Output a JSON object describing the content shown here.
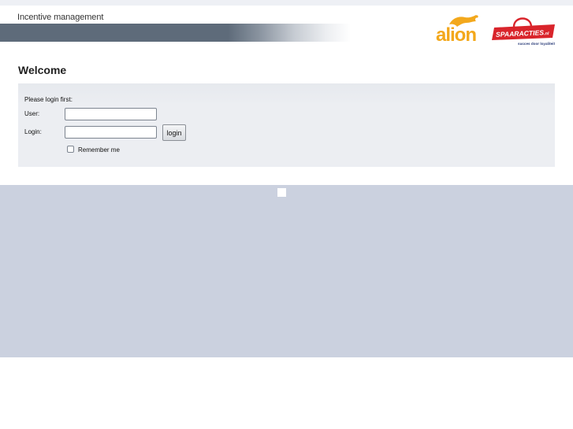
{
  "header": {
    "tagline": "Incentive management",
    "logos": {
      "alion": {
        "text": "alion",
        "color": "#f3a81c"
      },
      "spaaracties": {
        "text": "SPAARACTIES",
        "suffix": ".nl",
        "slogan": "succes door loyaliteit",
        "color": "#d9242b"
      }
    }
  },
  "main": {
    "title": "Welcome",
    "form": {
      "prompt": "Please login first:",
      "user_label": "User:",
      "user_value": "",
      "login_label": "Login:",
      "login_value": "",
      "submit_label": "login",
      "remember_label": "Remember me",
      "remember_checked": false
    }
  },
  "colors": {
    "header_bar": "#5e6b7a",
    "panel_bg": "#eceef2",
    "bottom_band": "#cbd1df"
  }
}
